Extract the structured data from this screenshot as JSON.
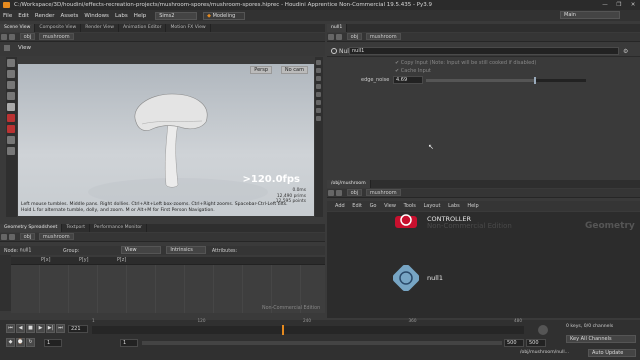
{
  "window": {
    "title": "C:/Workspace/3D/houdini/effects-recreation-projects/mushroom-spores/mushroom-spores.hiprec - Houdini Apprentice Non-Commercial 19.5.435 - Py3.9",
    "controls": [
      "—",
      "❐",
      "✕"
    ]
  },
  "menubar": {
    "items": [
      "File",
      "Edit",
      "Render",
      "Assets",
      "Windows",
      "Labs",
      "Help"
    ],
    "desktop": "Sims2",
    "shelf": "Modeling",
    "desktop_right": "Main"
  },
  "left_panel": {
    "tabs": [
      "Scene View",
      "Composite View",
      "Render View",
      "Animation Editor",
      "Motion FX View"
    ],
    "path": {
      "context": "obj",
      "node": "mushroom"
    },
    "view_label": "View",
    "camera": "Persp",
    "cam_menu": "No cam",
    "fps": ">120.0fps",
    "stats": [
      "0.0ms",
      "12,490 prims",
      "12,595 points"
    ],
    "help_text": "Left mouse tumbles. Middle pans. Right dollies. Ctrl+Alt+Left box-zooms. Ctrl+Right zooms. Spacebar-Ctrl-Left tilts. Hold L for alternate tumble, dolly, and zoom.   M or Alt+M for First Person Navigation."
  },
  "spreadsheet": {
    "tabs": [
      "Geometry Spreadsheet",
      "Textport",
      "Performance Monitor"
    ],
    "path": {
      "context": "obj",
      "node": "mushroom"
    },
    "node_label": "Node:",
    "node_value": "null1",
    "group_label": "Group:",
    "view_label": "View",
    "intrinsics": "Intrinsics",
    "attributes": "Attributes:",
    "columns": [
      "P[x]",
      "P[y]",
      "P[z]"
    ],
    "watermark": "Non-Commercial Edition"
  },
  "parms": {
    "tab": "null1",
    "path": {
      "context": "obj",
      "node": "mushroom"
    },
    "node_type": "Null",
    "node_name": "null1",
    "copy_input_label": "Copy Input (Note: Input will be still cooked if disabled)",
    "cache_input_label": "Cache Input",
    "edge_noise_label": "edge_noise",
    "edge_noise_value": "4.69",
    "edge_noise_fraction": 0.68
  },
  "network": {
    "tab": "/obj/mushroom",
    "path": {
      "context": "obj",
      "node": "mushroom"
    },
    "menu": [
      "Add",
      "Edit",
      "Go",
      "View",
      "Tools",
      "Layout",
      "Labs",
      "Help"
    ],
    "watermark": "Non-Commercial Edition",
    "context_label": "Geometry",
    "nodes": [
      {
        "name": "CONTROLLER",
        "color": "#c8102e"
      },
      {
        "name": "null1",
        "color": "#7fb3d5"
      }
    ]
  },
  "timeline": {
    "frame": "221",
    "start": "1",
    "start2": "1",
    "end": "500",
    "end2": "500",
    "ticks": [
      "1",
      "120",
      "240",
      "360",
      "480"
    ],
    "playhead_fraction": 0.44,
    "keys_info": "0 keys, 0/0 channels",
    "key_all": "Key All Channels",
    "status_path": "/obj/mushroom/null...",
    "auto_update": "Auto Update"
  }
}
